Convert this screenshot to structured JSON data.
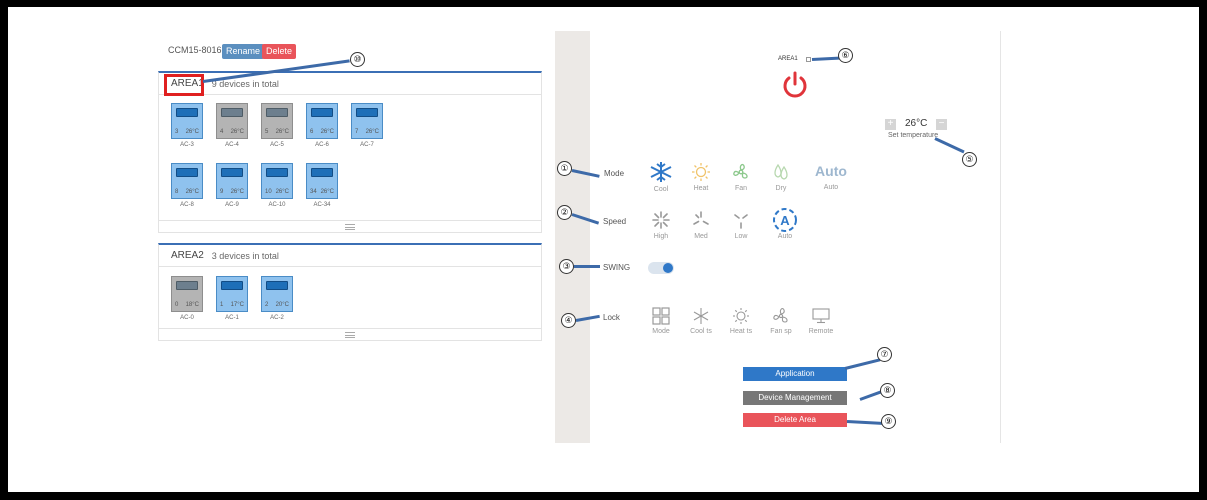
{
  "header": {
    "device_id": "CCM15-8016",
    "rename_label": "Rename",
    "delete_label": "Delete"
  },
  "area1": {
    "name": "AREA1",
    "count_text": "9 devices in total",
    "devices": [
      {
        "num": "3",
        "temp": "26°C",
        "label": "AC-3",
        "state": "on"
      },
      {
        "num": "4",
        "temp": "26°C",
        "label": "AC-4",
        "state": "off"
      },
      {
        "num": "5",
        "temp": "26°C",
        "label": "AC-5",
        "state": "off"
      },
      {
        "num": "6",
        "temp": "26°C",
        "label": "AC-6",
        "state": "on"
      },
      {
        "num": "7",
        "temp": "26°C",
        "label": "AC-7",
        "state": "on"
      },
      {
        "num": "8",
        "temp": "26°C",
        "label": "AC-8",
        "state": "on"
      },
      {
        "num": "9",
        "temp": "26°C",
        "label": "AC-9",
        "state": "on"
      },
      {
        "num": "10",
        "temp": "26°C",
        "label": "AC-10",
        "state": "on"
      },
      {
        "num": "34",
        "temp": "26°C",
        "label": "AC-34",
        "state": "on"
      }
    ]
  },
  "area2": {
    "name": "AREA2",
    "count_text": "3 devices in total",
    "devices": [
      {
        "num": "0",
        "temp": "18°C",
        "label": "AC-0",
        "state": "off"
      },
      {
        "num": "1",
        "temp": "17°C",
        "label": "AC-1",
        "state": "on"
      },
      {
        "num": "2",
        "temp": "20°C",
        "label": "AC-2",
        "state": "on"
      }
    ]
  },
  "control": {
    "area_title": "AREA1",
    "temperature": "26°C",
    "set_temp_label": "Set temperature",
    "temp_plus": "+",
    "temp_minus": "−",
    "mode_label": "Mode",
    "modes": [
      "Cool",
      "Heat",
      "Fan",
      "Dry",
      "Auto"
    ],
    "auto_big": "Auto",
    "speed_label": "Speed",
    "speeds": [
      "High",
      "Med",
      "Low",
      "Auto"
    ],
    "swing_label": "SWING",
    "swing_on": true,
    "lock_label": "Lock",
    "locks": [
      "Mode",
      "Cool ts",
      "Heat ts",
      "Fan sp",
      "Remote"
    ],
    "application_label": "Application",
    "device_mgmt_label": "Device Management",
    "delete_area_label": "Delete Area"
  },
  "callouts": [
    "①",
    "②",
    "③",
    "④",
    "⑤",
    "⑥",
    "⑦",
    "⑧",
    "⑨",
    "⑩"
  ],
  "colors": {
    "accent_blue": "#3b6fb5",
    "power_red": "#e0343a",
    "delete_red": "#e9545a",
    "rename_blue": "#5b8fbf",
    "device_mgmt_gray": "#777777",
    "application_blue": "#2f78c8"
  }
}
